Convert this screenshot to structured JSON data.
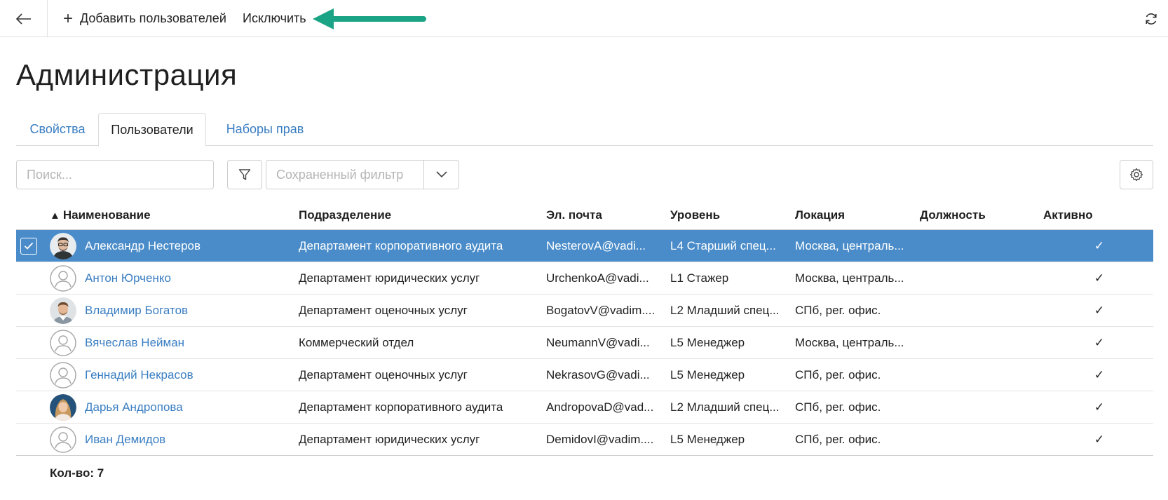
{
  "toolbar": {
    "back_icon": "arrow-left-icon",
    "add_users_label": "Добавить пользователей",
    "exclude_label": "Исключить",
    "annotation_arrow_color": "#1aa385",
    "refresh_icon": "refresh-icon"
  },
  "page": {
    "title": "Администрация"
  },
  "tabs": [
    {
      "label": "Свойства",
      "active": false
    },
    {
      "label": "Пользователи",
      "active": true
    },
    {
      "label": "Наборы прав",
      "active": false
    }
  ],
  "filters": {
    "search_placeholder": "Поиск...",
    "saved_filter_placeholder": "Сохраненный фильтр"
  },
  "table": {
    "columns": {
      "name": "Наименование",
      "name_sort": "▲",
      "dept": "Подразделение",
      "email": "Эл. почта",
      "level": "Уровень",
      "location": "Локация",
      "position": "Должность",
      "active": "Активно"
    },
    "rows": [
      {
        "name": "Александр Нестеров",
        "dept": "Департамент корпоративного аудита",
        "email": "NesterovA@vadi...",
        "level": "L4 Старший спец...",
        "location": "Москва, централь...",
        "position": "",
        "active": "✓",
        "selected": true,
        "avatar": "photo-man-glasses"
      },
      {
        "name": "Антон Юрченко",
        "dept": "Департамент юридических услуг",
        "email": "UrchenkoA@vadi...",
        "level": "L1 Стажер",
        "location": "Москва, централь...",
        "position": "",
        "active": "✓",
        "selected": false,
        "avatar": "placeholder"
      },
      {
        "name": "Владимир Богатов",
        "dept": "Департамент оценочных услуг",
        "email": "BogatovV@vadim....",
        "level": "L2 Младший спец...",
        "location": "СПб, рег. офис.",
        "position": "",
        "active": "✓",
        "selected": false,
        "avatar": "photo-man"
      },
      {
        "name": "Вячеслав Нейман",
        "dept": "Коммерческий отдел",
        "email": "NeumannV@vadi...",
        "level": "L5 Менеджер",
        "location": "Москва, централь...",
        "position": "",
        "active": "✓",
        "selected": false,
        "avatar": "placeholder"
      },
      {
        "name": "Геннадий Некрасов",
        "dept": "Департамент оценочных услуг",
        "email": "NekrasovG@vadi...",
        "level": "L5 Менеджер",
        "location": "СПб, рег. офис.",
        "position": "",
        "active": "✓",
        "selected": false,
        "avatar": "placeholder"
      },
      {
        "name": "Дарья Андропова",
        "dept": "Департамент корпоративного аудита",
        "email": "AndropovaD@vad...",
        "level": "L2 Младший спец...",
        "location": "СПб, рег. офис.",
        "position": "",
        "active": "✓",
        "selected": false,
        "avatar": "photo-woman"
      },
      {
        "name": "Иван Демидов",
        "dept": "Департамент юридических услуг",
        "email": "DemidovI@vadim....",
        "level": "L5 Менеджер",
        "location": "СПб, рег. офис.",
        "position": "",
        "active": "✓",
        "selected": false,
        "avatar": "placeholder"
      }
    ],
    "count_label": "Кол-во: 7"
  },
  "colors": {
    "accent": "#3a7ec2",
    "selected_row": "#4a8cc9",
    "annotation_arrow": "#1aa385"
  }
}
